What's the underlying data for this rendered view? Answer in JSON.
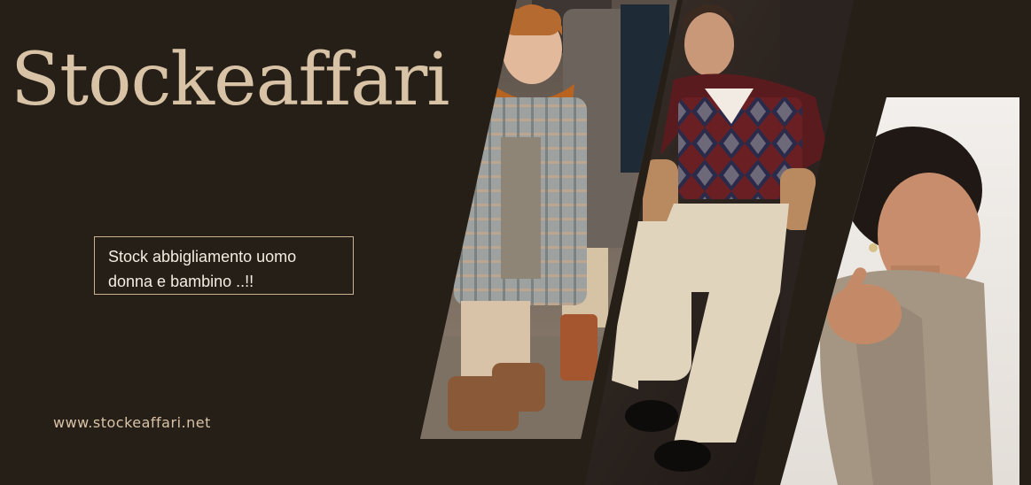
{
  "brand": {
    "name": "Stockeaffari"
  },
  "tagline": {
    "line1": "Stock abbigliamento uomo",
    "line2": "donna e bambino ..!!"
  },
  "website": {
    "url": "www.stockeaffari.net"
  },
  "colors": {
    "background": "#261f18",
    "brand_text": "#d8c3a6",
    "box_border": "#c9b28f",
    "tagline_text": "#f3ece2"
  },
  "images": [
    {
      "name": "children-photo",
      "depicts": "two children in winter coats, knit hat and scarf, leather boots"
    },
    {
      "name": "man-photo",
      "depicts": "man in argyle sweater vest and beige trousers seated"
    },
    {
      "name": "woman-photo",
      "depicts": "woman in beige knit scarf touching her face"
    }
  ]
}
